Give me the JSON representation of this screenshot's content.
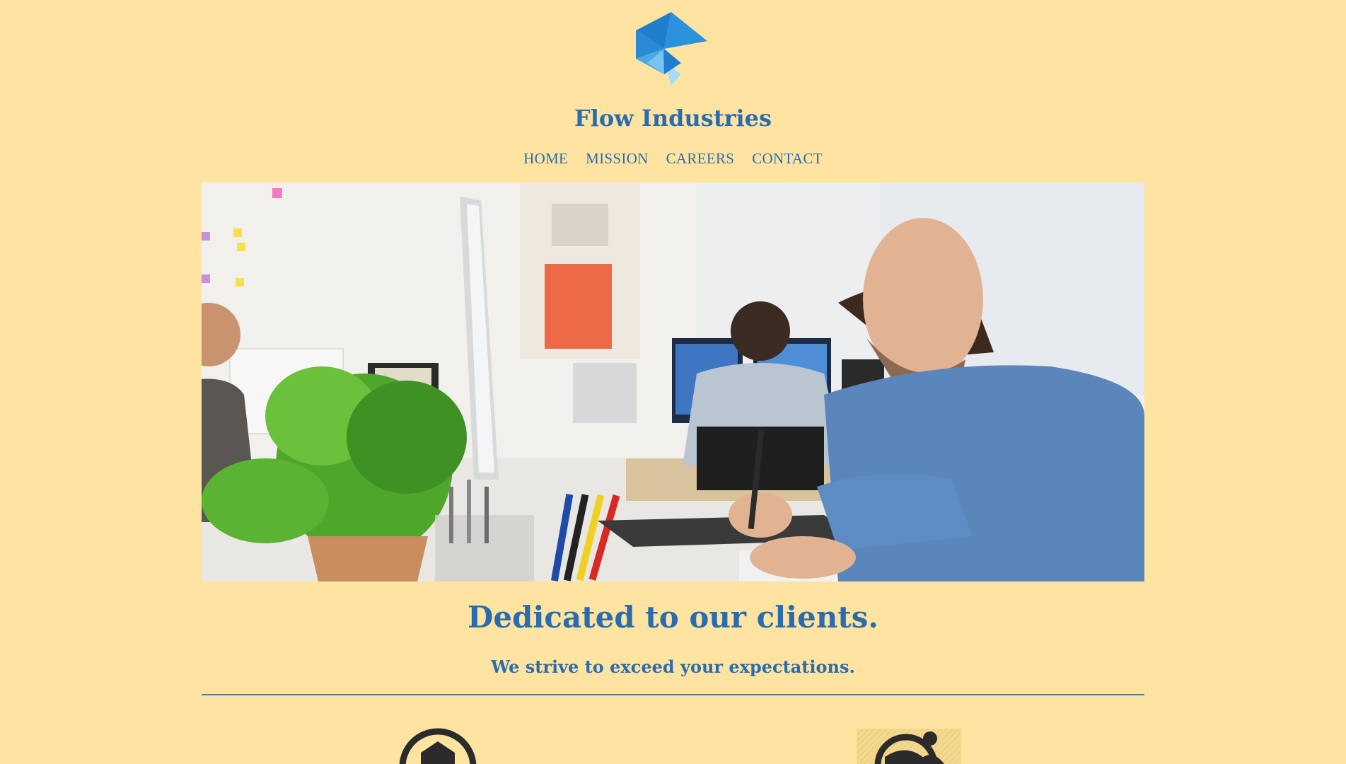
{
  "brand": {
    "name": "Flow Industries",
    "logo_icon": "geometric-bird-logo",
    "colors": {
      "primary": "#2a6cb0",
      "logo_dark": "#1e7fcc",
      "logo_light": "#7cc6ef",
      "background": "#ffe4a1"
    }
  },
  "nav": {
    "items": [
      {
        "label": "HOME"
      },
      {
        "label": "MISSION"
      },
      {
        "label": "CAREERS"
      },
      {
        "label": "CONTACT"
      }
    ]
  },
  "hero": {
    "image_subject": "office-worker-at-desk-photo"
  },
  "intro": {
    "headline": "Dedicated to our clients.",
    "subline": "We strive to exceed your expectations."
  },
  "features": {
    "icons": [
      "home-badge-icon",
      "global-people-icon"
    ]
  }
}
